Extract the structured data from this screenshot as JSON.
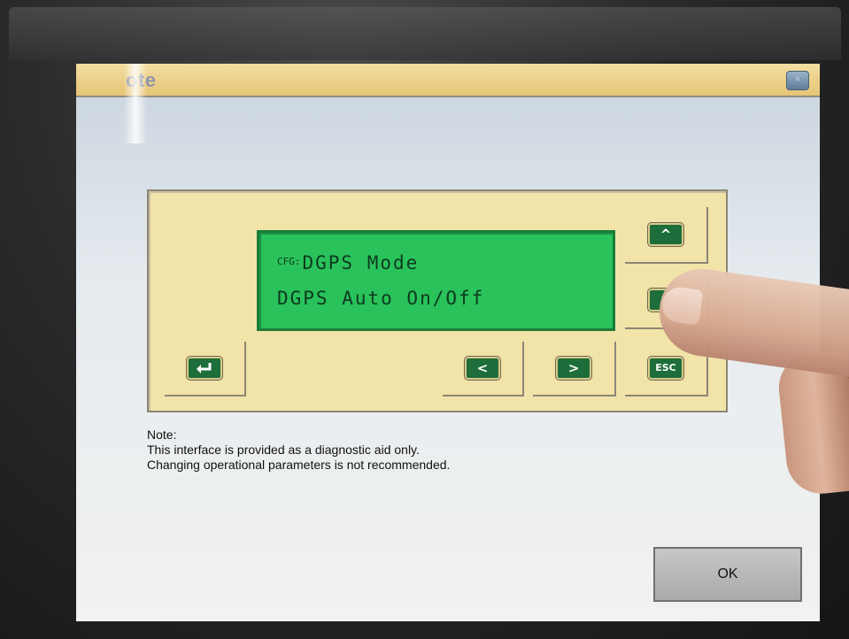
{
  "window": {
    "title": "ote",
    "corner_icon": "camera-icon"
  },
  "lcd": {
    "line1_prefix": "CFG:",
    "line1": "DGPS Mode",
    "line2": "DGPS Auto On/Off"
  },
  "keys": {
    "up": "^",
    "down": "v",
    "enter_icon": "enter-icon",
    "left": "<",
    "right": ">",
    "esc": "ESC"
  },
  "note": {
    "heading": "Note:",
    "line1": "This interface is provided as a diagnostic aid only.",
    "line2": "Changing operational parameters is not recommended."
  },
  "buttons": {
    "ok": "OK"
  },
  "colors": {
    "panel": "#f2e3a9",
    "lcd": "#29c25b",
    "key": "#1d6e3a",
    "title_bar": "#e6c575"
  }
}
